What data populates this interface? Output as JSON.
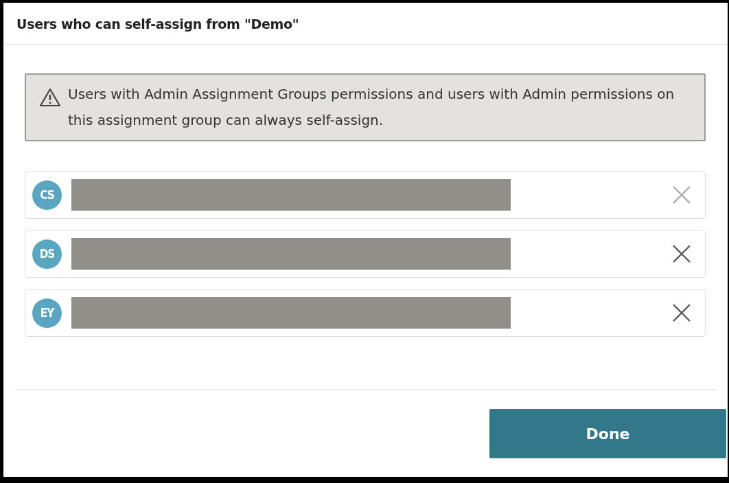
{
  "dialog": {
    "title": "Users who can self-assign from \"Demo\""
  },
  "notice": {
    "text": "Users with Admin Assignment Groups permissions and users with Admin permissions on this assignment group can always self-assign."
  },
  "users": [
    {
      "initials": "CS",
      "remove_disabled": true
    },
    {
      "initials": "DS",
      "remove_disabled": false
    },
    {
      "initials": "EY",
      "remove_disabled": false
    }
  ],
  "buttons": [
    {
      "label": "Done"
    }
  ]
}
